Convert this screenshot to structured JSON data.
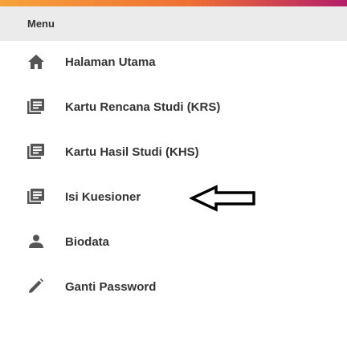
{
  "menu": {
    "header": "Menu",
    "items": [
      {
        "label": "Halaman Utama",
        "icon": "home-icon"
      },
      {
        "label": "Kartu Rencana Studi (KRS)",
        "icon": "document-list-icon"
      },
      {
        "label": "Kartu Hasil Studi (KHS)",
        "icon": "document-list-icon"
      },
      {
        "label": "Isi Kuesioner",
        "icon": "document-list-icon"
      },
      {
        "label": "Biodata",
        "icon": "person-icon"
      },
      {
        "label": "Ganti Password",
        "icon": "pencil-icon"
      }
    ]
  },
  "annotation": {
    "icon": "arrow-left-outline-icon"
  },
  "colors": {
    "accent_start": "#f6a23a",
    "accent_mid": "#ef6f34",
    "accent_end": "#b51e6a",
    "header_bg": "#ebebeb",
    "text": "#333333",
    "icon": "#555555"
  }
}
